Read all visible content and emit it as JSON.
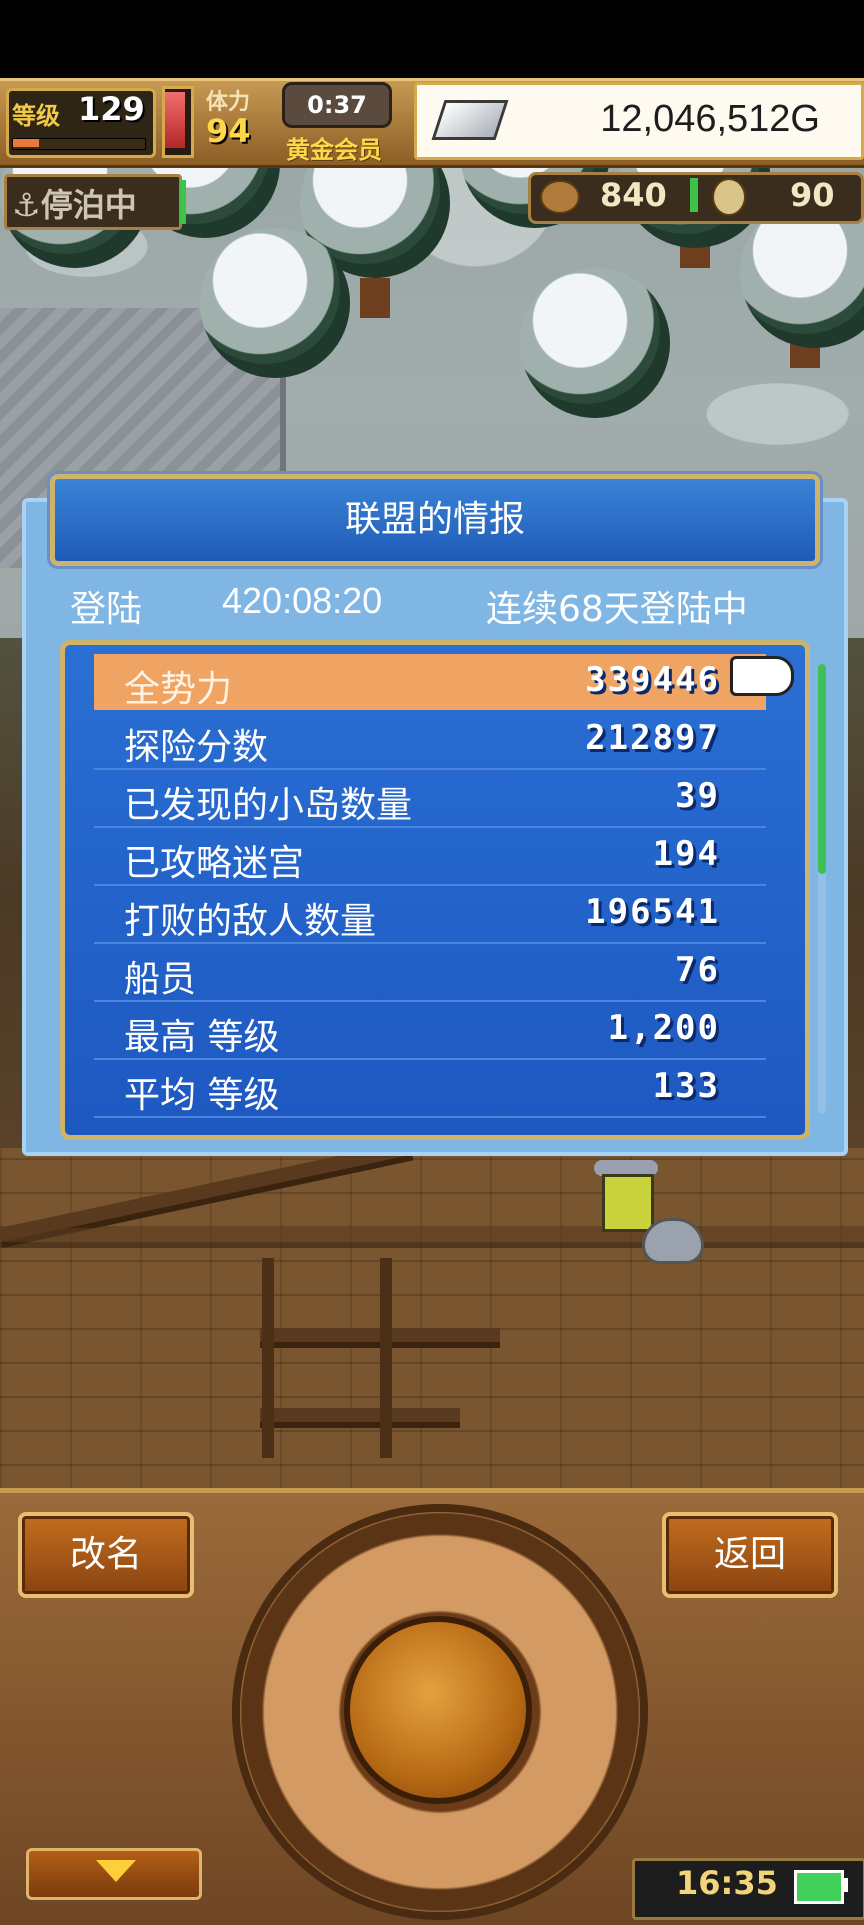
{
  "hud": {
    "level_label": "等级",
    "level": "129",
    "level_progress": 0.2,
    "stamina_label": "体力",
    "stamina": "94",
    "timer": "0:37",
    "membership": "黄金会员",
    "gold": "12,046,512G",
    "dock_status": "停泊中",
    "resource1": "840",
    "resource2": "90"
  },
  "dialog": {
    "title": "联盟的情报",
    "login_label": "登陆",
    "login_time": "420:08:20",
    "login_streak": "连续68天登陆中",
    "stats": [
      {
        "label": "全势力",
        "value": "339446",
        "selected": true
      },
      {
        "label": "探险分数",
        "value": "212897"
      },
      {
        "label": "已发现的小岛数量",
        "value": "39"
      },
      {
        "label": "已攻略迷宫",
        "value": "194"
      },
      {
        "label": "打败的敌人数量",
        "value": "196541"
      },
      {
        "label": "船员",
        "value": "76"
      },
      {
        "label": "最高 等级",
        "value": "1,200"
      },
      {
        "label": "平均 等级",
        "value": "133"
      }
    ]
  },
  "controls": {
    "rename_label": "改名",
    "back_label": "返回",
    "clock": "16:35"
  },
  "colors": {
    "dialog_blue": "#1d58c0",
    "selected_row": "#f0a463",
    "button_orange": "#c26d1f"
  }
}
